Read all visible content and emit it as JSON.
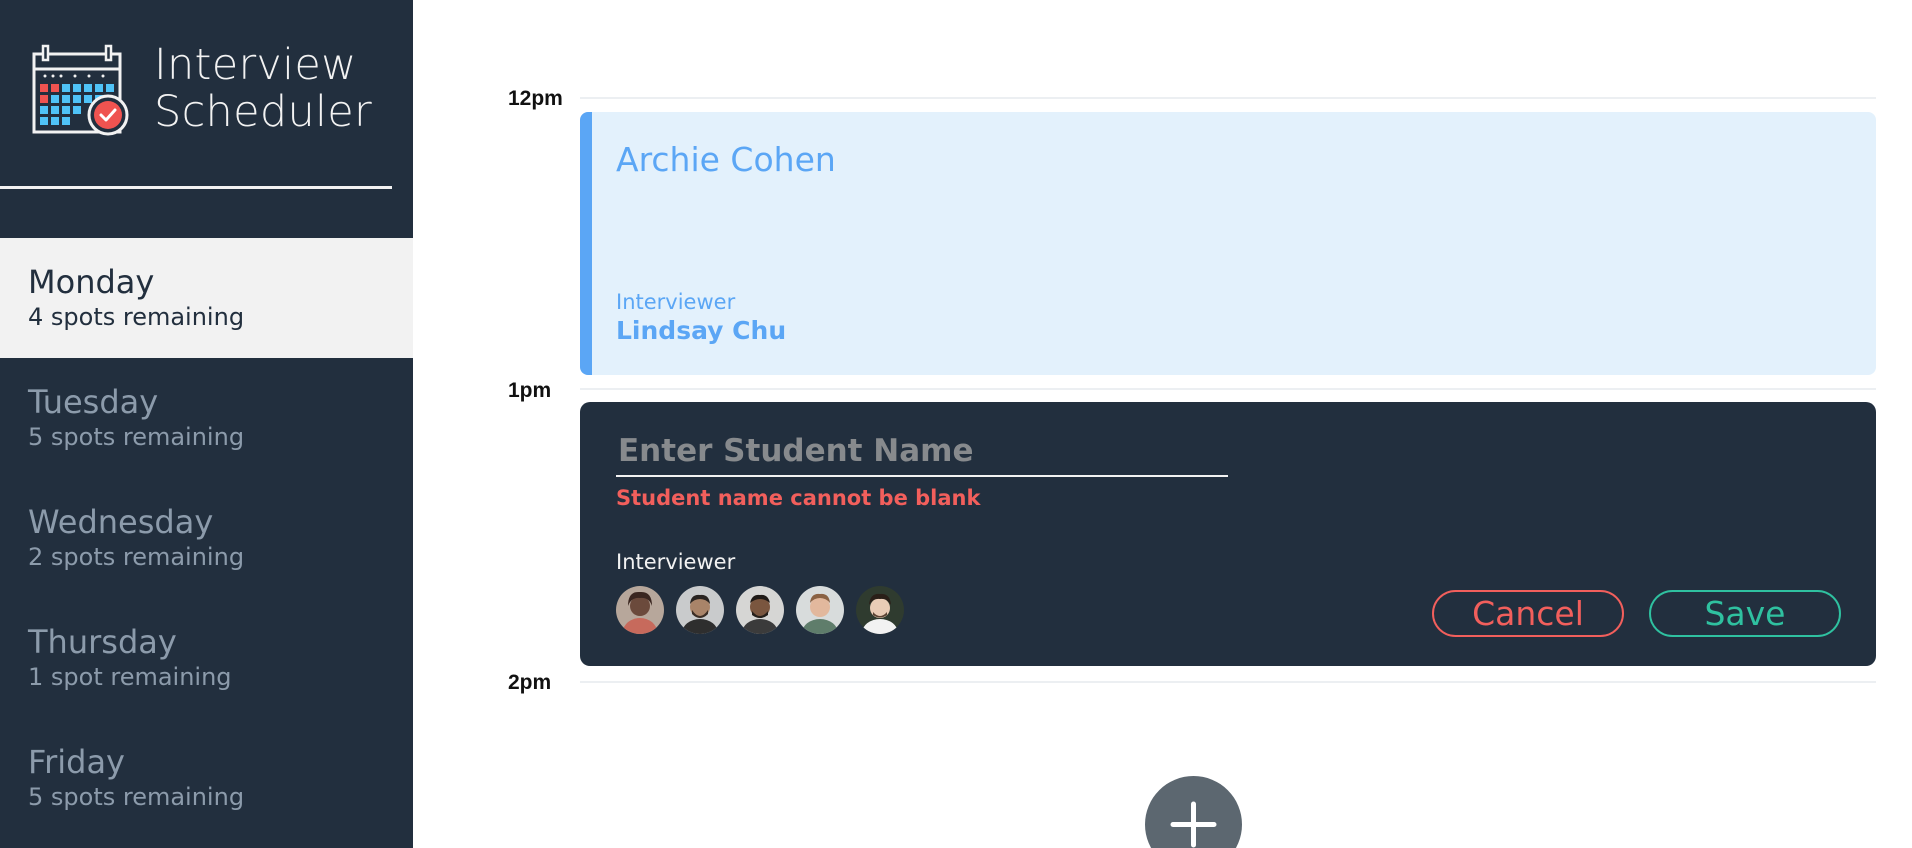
{
  "app": {
    "title_line1": "Interview",
    "title_line2": "Scheduler",
    "logo_icon": "calendar-check-icon"
  },
  "sidebar": {
    "days": [
      {
        "name": "Monday",
        "spots": "4 spots remaining",
        "selected": true
      },
      {
        "name": "Tuesday",
        "spots": "5 spots remaining",
        "selected": false
      },
      {
        "name": "Wednesday",
        "spots": "2 spots remaining",
        "selected": false
      },
      {
        "name": "Thursday",
        "spots": "1 spot remaining",
        "selected": false
      },
      {
        "name": "Friday",
        "spots": "5 spots remaining",
        "selected": false
      }
    ]
  },
  "schedule": {
    "slots": [
      {
        "label": "12pm"
      },
      {
        "label": "1pm"
      },
      {
        "label": "2pm"
      }
    ],
    "appointment": {
      "student": "Archie Cohen",
      "interviewer_caption": "Interviewer",
      "interviewer": "Lindsay Chu"
    },
    "form": {
      "student_placeholder": "Enter Student Name",
      "student_value": "",
      "error": "Student name cannot be blank",
      "interviewer_caption": "Interviewer",
      "interviewers": [
        {
          "icon": "interviewer-avatar-icon"
        },
        {
          "icon": "interviewer-avatar-icon"
        },
        {
          "icon": "interviewer-avatar-icon"
        },
        {
          "icon": "interviewer-avatar-icon"
        },
        {
          "icon": "interviewer-avatar-icon"
        }
      ],
      "cancel_label": "Cancel",
      "save_label": "Save"
    },
    "add_icon": "plus-icon"
  },
  "colors": {
    "sidebar_bg": "#222f3e",
    "appointment_bg": "#e3f1fc",
    "appointment_accent": "#5ba6f5",
    "error": "#f25f5c",
    "save": "#2fc1a0"
  }
}
